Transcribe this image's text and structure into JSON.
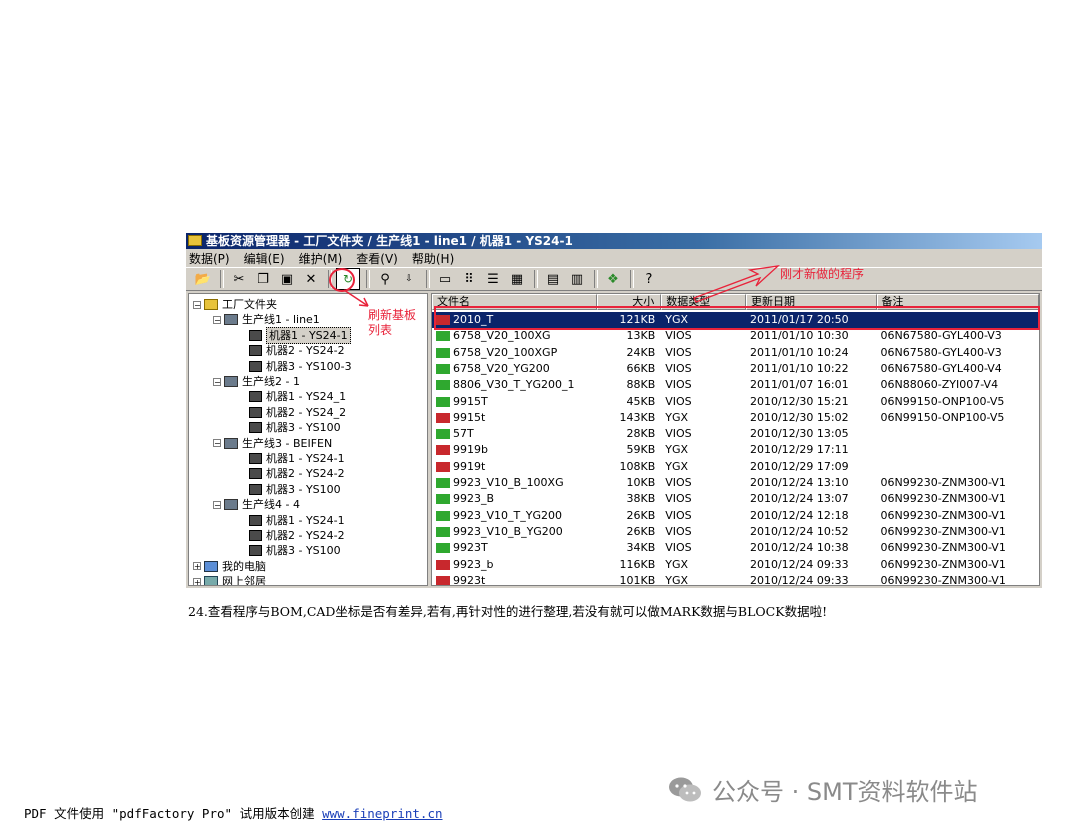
{
  "window": {
    "title": "基板资源管理器 - 工厂文件夹 / 生产线1 - line1 / 机器1 - YS24-1",
    "menus": [
      "数据(P)",
      "编辑(E)",
      "维护(M)",
      "查看(V)",
      "帮助(H)"
    ]
  },
  "tree": [
    {
      "label": "工厂文件夹",
      "level": 0,
      "icon": "folder-icon",
      "toggle": "−"
    },
    {
      "label": "生产线1 - line1",
      "level": 1,
      "icon": "line-icon",
      "toggle": "−"
    },
    {
      "label": "机器1 - YS24-1",
      "level": 2,
      "icon": "machine-icon",
      "toggle": "",
      "selected": true
    },
    {
      "label": "机器2 - YS24-2",
      "level": 2,
      "icon": "machine-icon",
      "toggle": ""
    },
    {
      "label": "机器3 - YS100-3",
      "level": 2,
      "icon": "machine-icon",
      "toggle": ""
    },
    {
      "label": "生产线2 - 1",
      "level": 1,
      "icon": "line-icon",
      "toggle": "−"
    },
    {
      "label": "机器1 - YS24_1",
      "level": 2,
      "icon": "machine-icon",
      "toggle": ""
    },
    {
      "label": "机器2 - YS24_2",
      "level": 2,
      "icon": "machine-icon",
      "toggle": ""
    },
    {
      "label": "机器3 - YS100",
      "level": 2,
      "icon": "machine-icon",
      "toggle": ""
    },
    {
      "label": "生产线3 - BEIFEN",
      "level": 1,
      "icon": "line-icon",
      "toggle": "−"
    },
    {
      "label": "机器1 - YS24-1",
      "level": 2,
      "icon": "machine-icon",
      "toggle": ""
    },
    {
      "label": "机器2 - YS24-2",
      "level": 2,
      "icon": "machine-icon",
      "toggle": ""
    },
    {
      "label": "机器3 - YS100",
      "level": 2,
      "icon": "machine-icon",
      "toggle": ""
    },
    {
      "label": "生产线4 - 4",
      "level": 1,
      "icon": "line-icon",
      "toggle": "−"
    },
    {
      "label": "机器1 - YS24-1",
      "level": 2,
      "icon": "machine-icon",
      "toggle": ""
    },
    {
      "label": "机器2 - YS24-2",
      "level": 2,
      "icon": "machine-icon",
      "toggle": ""
    },
    {
      "label": "机器3 - YS100",
      "level": 2,
      "icon": "machine-icon",
      "toggle": ""
    },
    {
      "label": "我的电脑",
      "level": 0,
      "icon": "computer-icon",
      "toggle": "+"
    },
    {
      "label": "网上邻居",
      "level": 0,
      "icon": "network-icon",
      "toggle": "+"
    }
  ],
  "list": {
    "columns": [
      "文件名",
      "大小",
      "数据类型",
      "更新日期",
      "备注"
    ],
    "rows": [
      {
        "name": "2010_T",
        "size": "121KB",
        "type": "YGX",
        "date": "2011/01/17 20:50",
        "note": "",
        "kind": "ygx",
        "selected": true
      },
      {
        "name": "6758_V20_100XG",
        "size": "13KB",
        "type": "VIOS",
        "date": "2011/01/10 10:30",
        "note": "06N67580-GYL400-V3",
        "kind": "vios"
      },
      {
        "name": "6758_V20_100XGP",
        "size": "24KB",
        "type": "VIOS",
        "date": "2011/01/10 10:24",
        "note": "06N67580-GYL400-V3",
        "kind": "vios"
      },
      {
        "name": "6758_V20_YG200",
        "size": "66KB",
        "type": "VIOS",
        "date": "2011/01/10 10:22",
        "note": "06N67580-GYL400-V4",
        "kind": "vios"
      },
      {
        "name": "8806_V30_T_YG200_1",
        "size": "88KB",
        "type": "VIOS",
        "date": "2011/01/07 16:01",
        "note": "06N88060-ZYI007-V4",
        "kind": "vios"
      },
      {
        "name": "9915T",
        "size": "45KB",
        "type": "VIOS",
        "date": "2010/12/30 15:21",
        "note": "06N99150-ONP100-V5",
        "kind": "vios"
      },
      {
        "name": "9915t",
        "size": "143KB",
        "type": "YGX",
        "date": "2010/12/30 15:02",
        "note": "06N99150-ONP100-V5",
        "kind": "ygx"
      },
      {
        "name": "57T",
        "size": "28KB",
        "type": "VIOS",
        "date": "2010/12/30 13:05",
        "note": "",
        "kind": "vios"
      },
      {
        "name": "9919b",
        "size": "59KB",
        "type": "YGX",
        "date": "2010/12/29 17:11",
        "note": "",
        "kind": "ygx"
      },
      {
        "name": "9919t",
        "size": "108KB",
        "type": "YGX",
        "date": "2010/12/29 17:09",
        "note": "",
        "kind": "ygx"
      },
      {
        "name": "9923_V10_B_100XG",
        "size": "10KB",
        "type": "VIOS",
        "date": "2010/12/24 13:10",
        "note": "06N99230-ZNM300-V1",
        "kind": "vios"
      },
      {
        "name": "9923_B",
        "size": "38KB",
        "type": "VIOS",
        "date": "2010/12/24 13:07",
        "note": "06N99230-ZNM300-V1",
        "kind": "vios"
      },
      {
        "name": "9923_V10_T_YG200",
        "size": "26KB",
        "type": "VIOS",
        "date": "2010/12/24 12:18",
        "note": "06N99230-ZNM300-V1",
        "kind": "vios"
      },
      {
        "name": "9923_V10_B_YG200",
        "size": "26KB",
        "type": "VIOS",
        "date": "2010/12/24 10:52",
        "note": "06N99230-ZNM300-V1",
        "kind": "vios"
      },
      {
        "name": "9923T",
        "size": "34KB",
        "type": "VIOS",
        "date": "2010/12/24 10:38",
        "note": "06N99230-ZNM300-V1",
        "kind": "vios"
      },
      {
        "name": "9923_b",
        "size": "116KB",
        "type": "YGX",
        "date": "2010/12/24 09:33",
        "note": "06N99230-ZNM300-V1",
        "kind": "ygx"
      },
      {
        "name": "9923t",
        "size": "101KB",
        "type": "YGX",
        "date": "2010/12/24 09:33",
        "note": "06N99230-ZNM300-V1",
        "kind": "ygx"
      }
    ]
  },
  "annotations": {
    "refresh": "刷新基板\n列表",
    "new_program": "刚才新做的程序",
    "color": "#e8233a"
  },
  "caption": "24.查看程序与BOM,CAD坐标是否有差异,若有,再针对性的进行整理,若没有就可以做MARK数据与BLOCK数据啦!",
  "footer": {
    "text": "PDF 文件使用 \"pdfFactory Pro\" 试用版本创建 ",
    "link": "www.fineprint.cn"
  },
  "watermark": "公众号 · SMT资料软件站",
  "colors": {
    "vios": "#2fa82f",
    "ygx": "#c8282d",
    "selection": "#0a246a"
  }
}
